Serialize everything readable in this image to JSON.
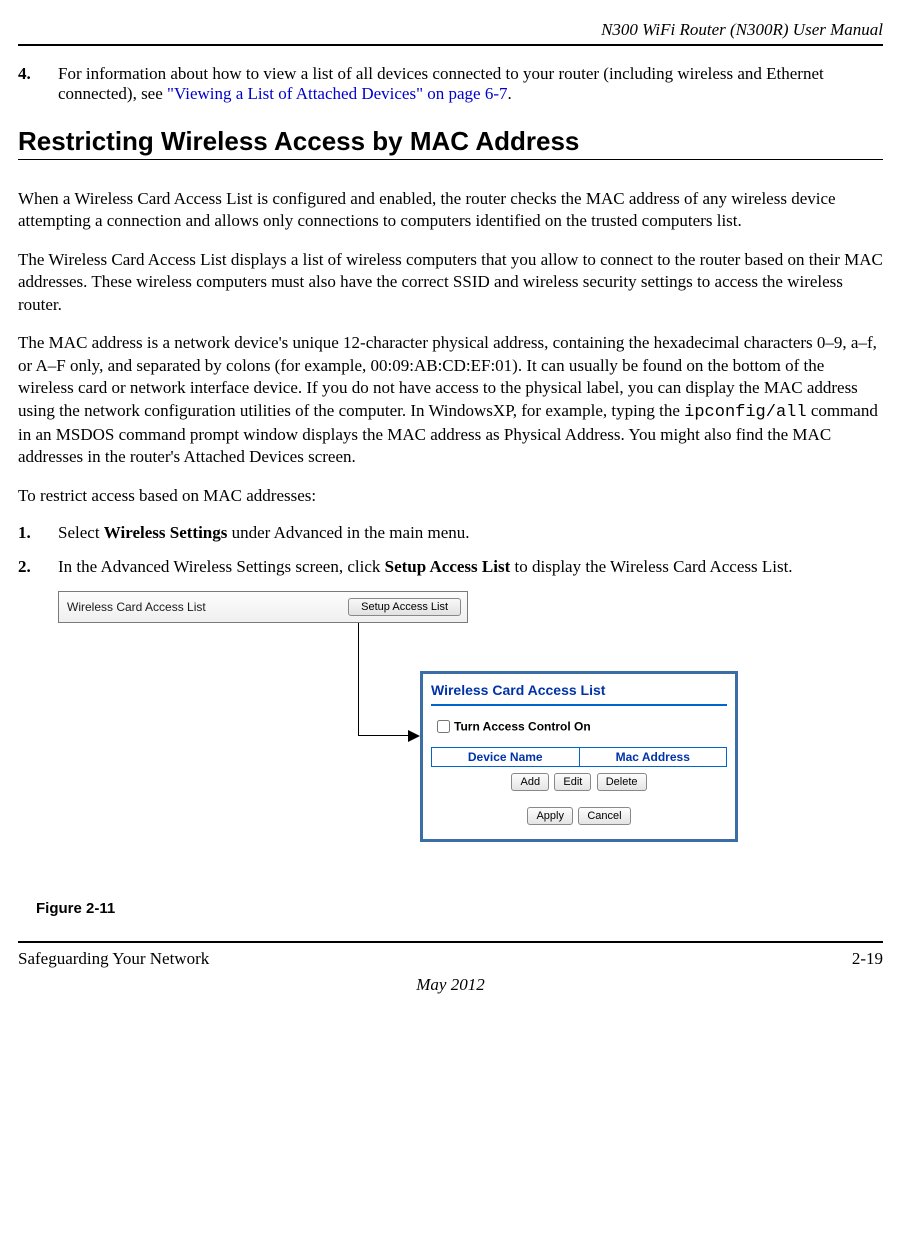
{
  "header": {
    "doc_title": "N300 WiFi Router (N300R) User Manual"
  },
  "step4": {
    "num": "4.",
    "text_a": "For information about how to view a list of all devices connected to your router (including wireless and Ethernet connected), see ",
    "link": "\"Viewing a List of Attached Devices\" on page 6-7",
    "text_b": "."
  },
  "section": {
    "heading": "Restricting Wireless Access by MAC Address"
  },
  "paras": {
    "p1": "When a Wireless Card Access List is configured and enabled, the router checks the MAC address of any wireless device attempting a connection and allows only connections to computers identified on the trusted computers list.",
    "p2": "The Wireless Card Access List displays a list of wireless computers that you allow to connect to the router based on their MAC addresses. These wireless computers must also have the correct SSID and wireless security settings to access the wireless router.",
    "p3a": "The MAC address is a network device's unique 12-character physical address, containing the hexadecimal characters 0–9, a–f, or A–F only, and separated by colons (for example, 00:09:AB:CD:EF:01). It can usually be found on the bottom of the wireless card or network interface device. If you do not have access to the physical label, you can display the MAC address using the network configuration utilities of the computer. In WindowsXP, for example, typing the ",
    "p3_cmd": "ipconfig/all",
    "p3b": " command in an MSDOS command prompt window displays the MAC address as Physical Address. You might also find the MAC addresses in the router's Attached Devices screen.",
    "p4": "To restrict access based on MAC addresses:"
  },
  "steps": {
    "s1": {
      "num": "1.",
      "a": "Select ",
      "b": "Wireless Settings",
      "c": " under Advanced in the main menu."
    },
    "s2": {
      "num": "2.",
      "a": "In the Advanced Wireless Settings screen, click ",
      "b": "Setup Access List",
      "c": " to display the Wireless Card Access List."
    }
  },
  "figure": {
    "strip_label": "Wireless Card Access List",
    "setup_btn": "Setup Access List",
    "dialog": {
      "title": "Wireless Card Access List",
      "checkbox_label": "Turn Access Control On",
      "col1": "Device Name",
      "col2": "Mac Address",
      "btn_add": "Add",
      "btn_edit": "Edit",
      "btn_delete": "Delete",
      "btn_apply": "Apply",
      "btn_cancel": "Cancel"
    },
    "caption": "Figure 2-11"
  },
  "footer": {
    "left": "Safeguarding Your Network",
    "right": "2-19",
    "date": "May 2012"
  }
}
